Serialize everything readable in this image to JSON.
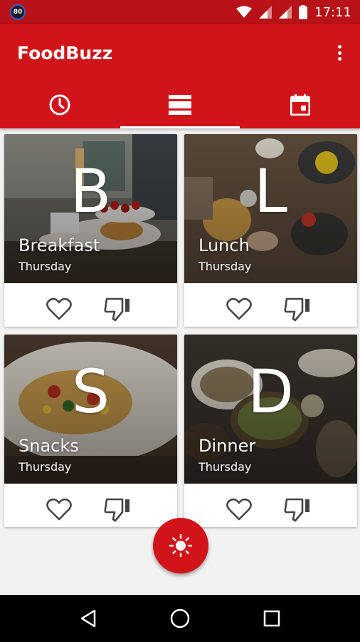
{
  "status_bar": {
    "badge": "80",
    "time": "17:11",
    "icons": [
      "wifi-icon",
      "signal-icon",
      "signal-icon",
      "battery-icon"
    ]
  },
  "app_bar": {
    "title": "FoodBuzz",
    "menu_icon": "more-vert-icon"
  },
  "tabs": [
    {
      "icon": "clock-icon",
      "active": false
    },
    {
      "icon": "list-icon",
      "active": true
    },
    {
      "icon": "calendar-icon",
      "active": false
    }
  ],
  "cards": [
    {
      "letter": "B",
      "title": "Breakfast",
      "day": "Thursday",
      "like_icon": "heart-outline-icon",
      "dislike_icon": "thumb-down-outline-icon"
    },
    {
      "letter": "L",
      "title": "Lunch",
      "day": "Thursday",
      "like_icon": "heart-outline-icon",
      "dislike_icon": "thumb-down-outline-icon"
    },
    {
      "letter": "S",
      "title": "Snacks",
      "day": "Thursday",
      "like_icon": "heart-outline-icon",
      "dislike_icon": "thumb-down-outline-icon"
    },
    {
      "letter": "D",
      "title": "Dinner",
      "day": "Thursday",
      "like_icon": "heart-outline-icon",
      "dislike_icon": "thumb-down-outline-icon"
    }
  ],
  "fab": {
    "icon": "sun-icon"
  },
  "nav_bar": {
    "icons": [
      "back-icon",
      "home-icon",
      "recents-icon"
    ]
  },
  "colors": {
    "primary": "#d0141a",
    "status_bar": "#b71217"
  }
}
